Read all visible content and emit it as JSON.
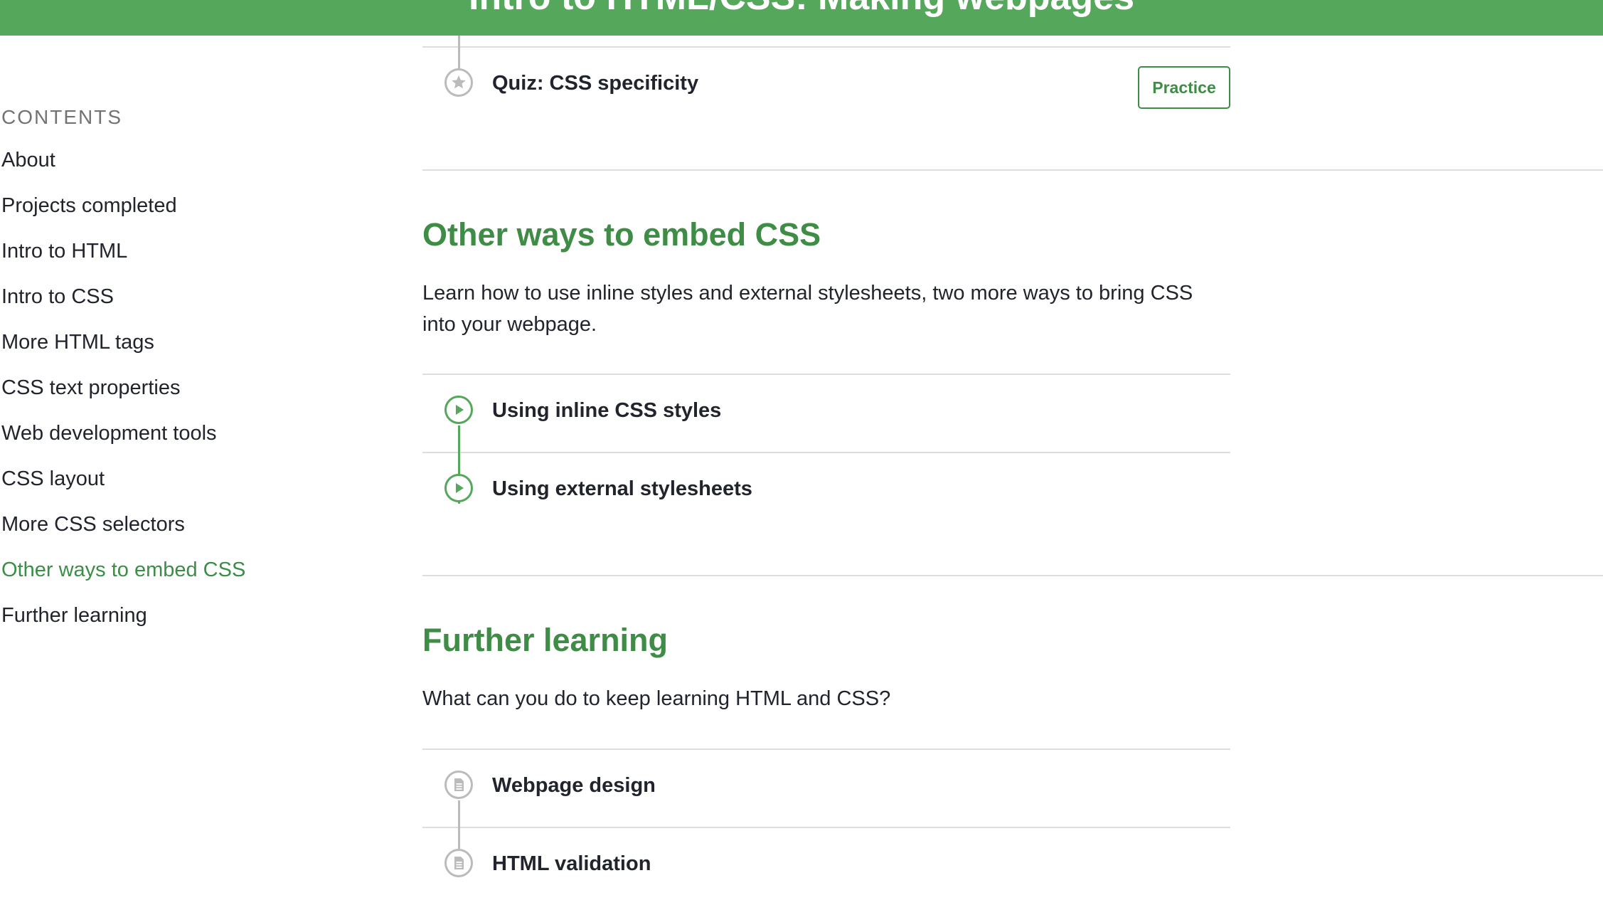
{
  "header": {
    "title": "Intro to HTML/CSS: Making webpages"
  },
  "sidebar": {
    "heading": "CONTENTS",
    "items": [
      {
        "label": "About"
      },
      {
        "label": "Projects completed"
      },
      {
        "label": "Intro to HTML"
      },
      {
        "label": "Intro to CSS"
      },
      {
        "label": "More HTML tags"
      },
      {
        "label": "CSS text properties"
      },
      {
        "label": "Web development tools"
      },
      {
        "label": "CSS layout"
      },
      {
        "label": "More CSS selectors"
      },
      {
        "label": "Other ways to embed CSS"
      },
      {
        "label": "Further learning"
      }
    ],
    "active_item": "Other ways to embed CSS"
  },
  "quiz": {
    "label": "Quiz: CSS specificity",
    "button_label": "Practice",
    "icon": "star-icon"
  },
  "sections": [
    {
      "title": "Other ways to embed CSS",
      "description": "Learn how to use inline styles and external stylesheets, two more ways to bring CSS into your webpage.",
      "items": [
        {
          "label": "Using inline CSS styles",
          "icon": "play-icon"
        },
        {
          "label": "Using external stylesheets",
          "icon": "play-icon"
        }
      ]
    },
    {
      "title": "Further learning",
      "description": "What can you do to keep learning HTML and CSS?",
      "items": [
        {
          "label": "Webpage design",
          "icon": "article-icon"
        },
        {
          "label": "HTML validation",
          "icon": "article-icon"
        }
      ]
    }
  ],
  "colors": {
    "brand_green": "#54a75b",
    "title_green": "#3e8c46",
    "text": "#21242c",
    "muted": "#737373",
    "rule": "#dddddd"
  }
}
